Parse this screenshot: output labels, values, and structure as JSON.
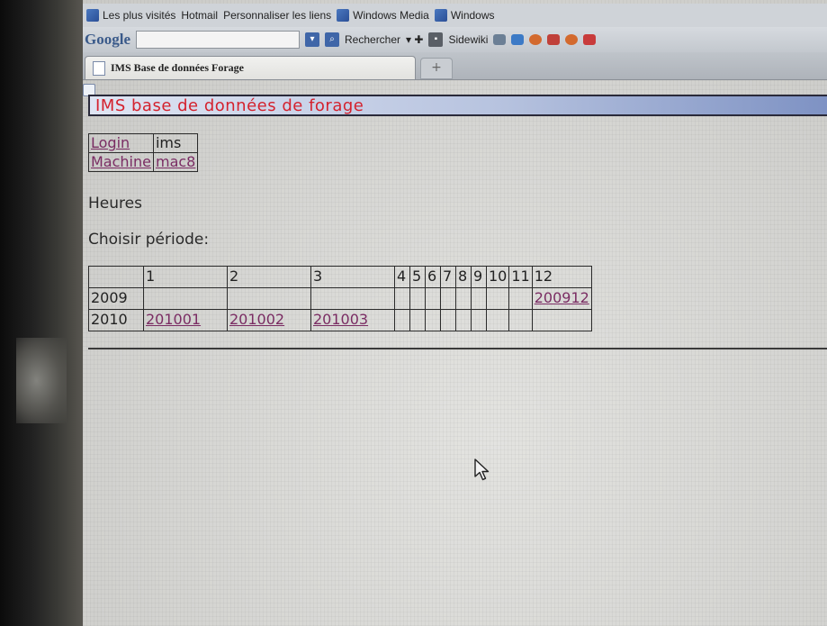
{
  "bookmarks": [
    {
      "label": "Les plus visités",
      "icon": "blue-folder-icon"
    },
    {
      "label": "Hotmail",
      "icon": "page-icon"
    },
    {
      "label": "Personnaliser les liens",
      "icon": "page-icon"
    },
    {
      "label": "Windows Media",
      "icon": "windows-icon"
    },
    {
      "label": "Windows",
      "icon": "windows-icon"
    }
  ],
  "toolbar": {
    "logo": "Google",
    "search_button": "Rechercher",
    "sidewiki_label": "Sidewiki"
  },
  "tab": {
    "title": "IMS Base de données Forage",
    "new_tab": "+"
  },
  "page": {
    "title": "IMS base de données de forage",
    "info": {
      "login_label": "Login",
      "login_value": "ims",
      "machine_label": "Machine",
      "machine_value": "mac8"
    },
    "heures": "Heures",
    "choisir": "Choisir période:",
    "period": {
      "months": [
        "1",
        "2",
        "3",
        "4",
        "5",
        "6",
        "7",
        "8",
        "9",
        "10",
        "11",
        "12"
      ],
      "rows": [
        {
          "year": "2009",
          "cells": [
            "",
            "",
            "",
            "",
            "",
            "",
            "",
            "",
            "",
            "",
            "",
            "200912"
          ]
        },
        {
          "year": "2010",
          "cells": [
            "201001",
            "201002",
            "201003",
            "",
            "",
            "",
            "",
            "",
            "",
            "",
            "",
            ""
          ]
        }
      ]
    }
  },
  "colors": {
    "title_red": "#d4222e",
    "link_purple": "#7a2c63",
    "title_bar_blue": "#7d91c3"
  }
}
